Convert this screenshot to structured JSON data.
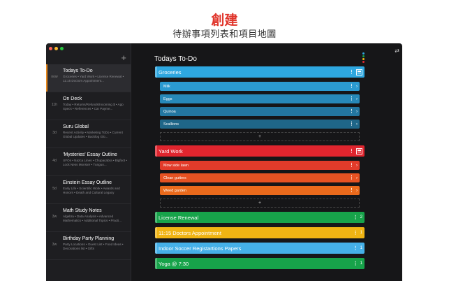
{
  "hero": {
    "title": "創建",
    "subtitle": "待辦事項列表和項目地圖"
  },
  "colors": {
    "accent_active": "#e8891d",
    "blue": "#2ea7e0",
    "red": "#e0252e",
    "green": "#17a34a",
    "yellow": "#f0b413",
    "light_blue": "#45b0e8"
  },
  "sidebar": {
    "add_icon": "plus-icon",
    "items": [
      {
        "time": "now",
        "title": "Todays To-Do",
        "preview": "Groceries • Yard Work • License Renewal • 11:15 Doctors Appointment..."
      },
      {
        "time": "11h",
        "title": "On Deck",
        "preview": "Today • Returns/Refunds/Incoming $ • App Specs • References • Car Payme..."
      },
      {
        "time": "3d",
        "title": "Suru Global",
        "preview": "Recent Activity • Marketing ToDo • Current Global Updates • Backlog Glo..."
      },
      {
        "time": "4d",
        "title": "'Mysteries' Essay Outline",
        "preview": "UFOs • Nazca Lines • Chupacabra • Bigfoot • Lock Ness Monster • Tunguo..."
      },
      {
        "time": "5d",
        "title": "Einstein Essay Outline",
        "preview": "Early Life • Scientific Work • Awards and Honors • Death and Cultural Legacy"
      },
      {
        "time": "3w",
        "title": "Math Study Notes",
        "preview": "Algebra • Data Analysis • Advanced Mathematics • Additional Topics • Practi..."
      },
      {
        "time": "3w",
        "title": "Birthday Party Planning",
        "preview": "Party Locations • Guest List • Food Ideas • Decorations list • Gifts"
      }
    ]
  },
  "main": {
    "title": "Todays To-Do",
    "add_label": "+",
    "groceries": {
      "label": "Groceries",
      "items": [
        "Milk",
        "Eggs",
        "Quinoa",
        "Scallions"
      ]
    },
    "yard_work": {
      "label": "Yard Work",
      "items": [
        "Mow side lawn",
        "Clean gutters",
        "Weed garden"
      ]
    },
    "tasks": [
      {
        "label": "License Renewal",
        "count": "2"
      },
      {
        "label": "11:15 Doctors Appointment",
        "count": "1"
      },
      {
        "label": "Indoor Soccer Registartions Papers",
        "count": "1"
      },
      {
        "label": "Yoga @ 7:30",
        "count": "1"
      }
    ]
  }
}
